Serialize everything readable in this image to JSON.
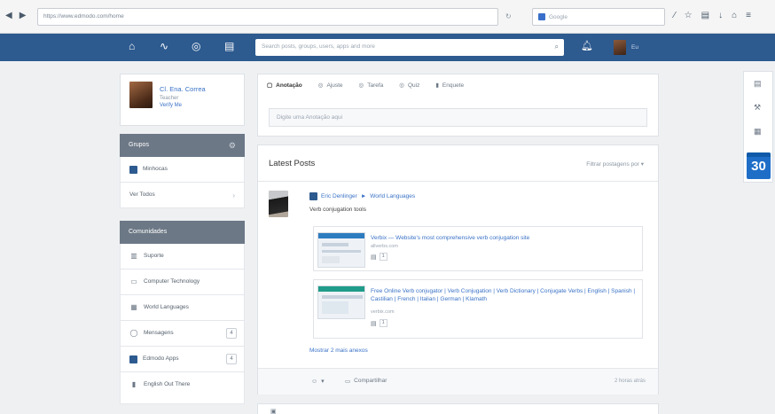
{
  "browser": {
    "url": "https://www.edmodo.com/home",
    "search_placeholder": "Google"
  },
  "header": {
    "search_placeholder": "Search posts, groups, users, apps and more",
    "user_label": "Eu"
  },
  "profile": {
    "name": "Cl. Ena. Correa",
    "role": "Teacher",
    "link": "Verify Me"
  },
  "groups": {
    "title": "Grupos",
    "items": [
      {
        "label": "Minhocas",
        "icon": "blue-square-icon"
      },
      {
        "label": "Ver Todos",
        "icon": ""
      }
    ]
  },
  "communities": {
    "title": "Comunidades",
    "items": [
      {
        "label": "Suporte",
        "icon": "book-icon"
      },
      {
        "label": "Computer Technology",
        "icon": "monitor-icon"
      },
      {
        "label": "World Languages",
        "icon": "globe-icon"
      },
      {
        "label": "Mensagens",
        "icon": "chat-icon",
        "badge": "4"
      },
      {
        "label": "Edmodo Apps",
        "icon": "apps-icon",
        "badge": "4"
      },
      {
        "label": "English Out There",
        "icon": "mobile-icon"
      }
    ]
  },
  "composer": {
    "tabs": [
      {
        "label": "Anotação",
        "icon": "note-icon"
      },
      {
        "label": "Ajuste",
        "icon": "adjust-icon"
      },
      {
        "label": "Tarefa",
        "icon": "task-icon"
      },
      {
        "label": "Quiz",
        "icon": "quiz-icon"
      },
      {
        "label": "Enquete",
        "icon": "poll-icon"
      }
    ],
    "placeholder": "Digite uma Anotação aqui"
  },
  "feed": {
    "title": "Latest Posts",
    "filter": "Filtrar postagens por",
    "post": {
      "author": "Eric Denlinger",
      "arrow": "►",
      "group": "World Languages",
      "text": "Verb conjugation tools",
      "links": [
        {
          "title": "Verbix — Website's most comprehensive verb conjugation site",
          "source": "allverbs.com",
          "count": "1"
        },
        {
          "title": "Free Online Verb conjugator | Verb Conjugation | Verb Dictionary | Conjugate Verbs | English | Spanish | Castilian | French | Italian | German | Klamath",
          "source": "verbix.com",
          "count": "1"
        }
      ],
      "show_more": "Mostrar 2 mais anexos",
      "share_label": "Compartilhar",
      "reply_count": "",
      "time": "2 horas atrás"
    }
  },
  "calendar": {
    "day": "30"
  }
}
